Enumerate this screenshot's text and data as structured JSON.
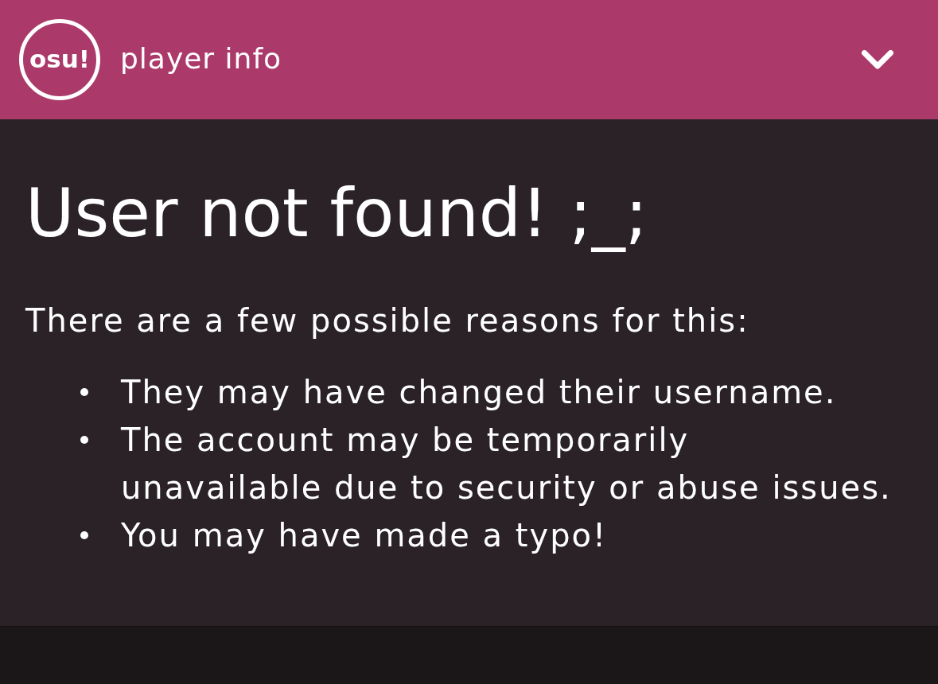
{
  "header": {
    "logo": "osu!",
    "title": "player info"
  },
  "content": {
    "heading": "User not found! ;_;",
    "intro": "There are a few possible reasons for this:",
    "reasons": [
      "They may have changed their username.",
      "The account may be temporarily unavailable due to security or abuse issues.",
      "You may have made a typo!"
    ]
  }
}
